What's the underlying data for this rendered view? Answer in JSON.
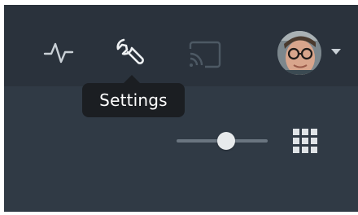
{
  "toolbar": {
    "icons": {
      "activity": "activity-icon",
      "settings": "wrench-icon",
      "cast": "cast-icon",
      "view_mode": "grid-icon",
      "account_menu": "chevron-down-icon"
    },
    "tooltip": "Settings"
  },
  "colors": {
    "topbar": "#2a323c",
    "content": "#303a45",
    "icon": "#c9d0d6",
    "tooltip_bg": "#1b1e22",
    "tooltip_text": "#ffffff"
  },
  "size_slider": {
    "value": 0.5
  }
}
